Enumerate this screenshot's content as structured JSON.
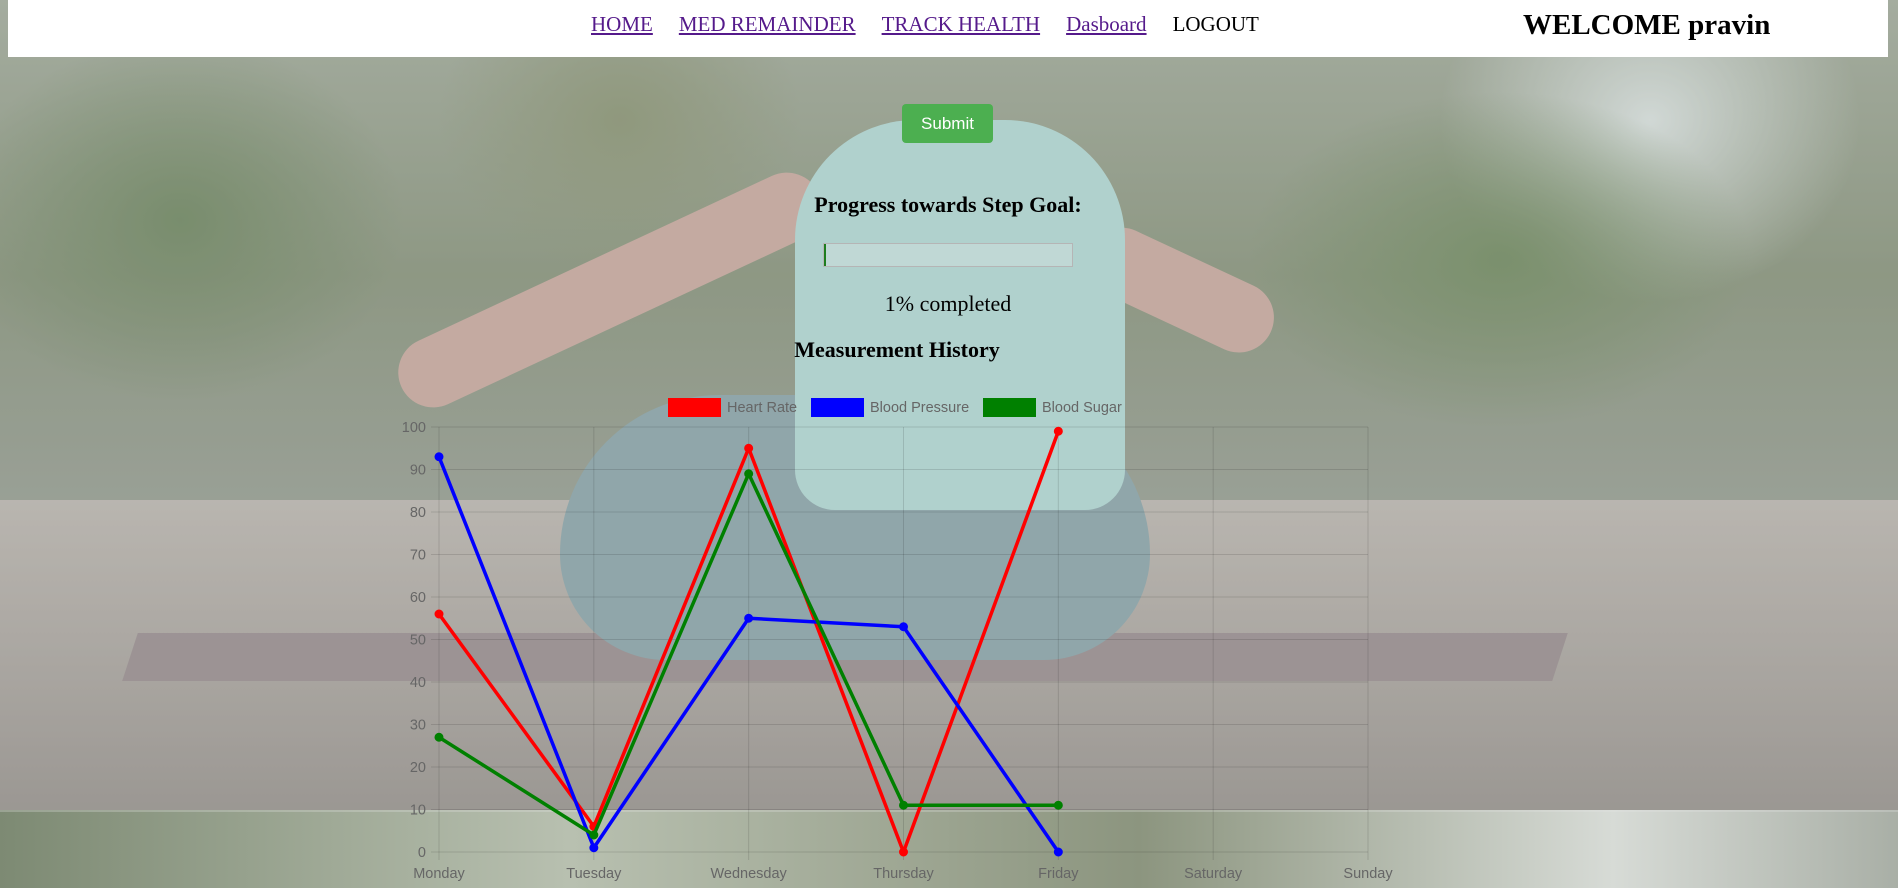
{
  "header": {
    "nav": [
      {
        "label": "HOME"
      },
      {
        "label": "MED REMAINDER"
      },
      {
        "label": "TRACK HEALTH"
      },
      {
        "label": "Dasboard"
      },
      {
        "label": "LOGOUT"
      }
    ],
    "welcome": "WELCOME pravin"
  },
  "main": {
    "submit_label": "Submit",
    "progress_title": "Progress towards Step Goal:",
    "progress_value": 0.01,
    "progress_text": "1% completed",
    "chart_title": "Measurement History"
  },
  "chart_data": {
    "type": "line",
    "title": "",
    "categories": [
      "Monday",
      "Tuesday",
      "Wednesday",
      "Thursday",
      "Friday",
      "Saturday",
      "Sunday"
    ],
    "ylim": [
      0,
      100
    ],
    "yticks": [
      0,
      10,
      20,
      30,
      40,
      50,
      60,
      70,
      80,
      90,
      100
    ],
    "grid": true,
    "legend_position": "top-center",
    "series": [
      {
        "name": "Heart Rate",
        "color": "#ff0000",
        "values": [
          56,
          6,
          95,
          0,
          99
        ]
      },
      {
        "name": "Blood Pressure",
        "color": "#0000ff",
        "values": [
          93,
          1,
          55,
          53,
          0
        ]
      },
      {
        "name": "Blood Sugar",
        "color": "#008000",
        "values": [
          27,
          4,
          89,
          11,
          11
        ]
      }
    ]
  }
}
